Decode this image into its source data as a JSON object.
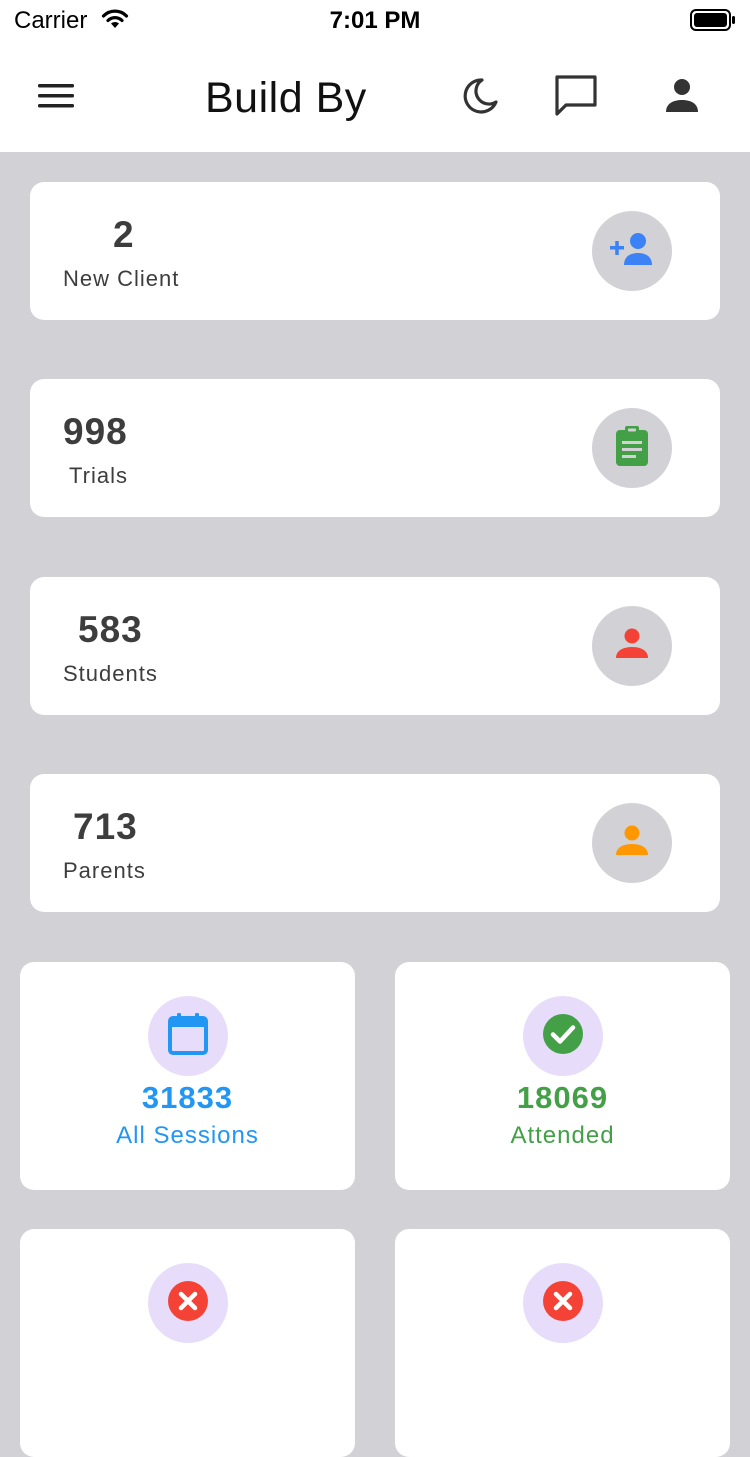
{
  "status_bar": {
    "carrier": "Carrier",
    "time": "7:01 PM"
  },
  "header": {
    "title": "Build By",
    "icons": [
      "menu-icon",
      "moon-icon",
      "chat-icon",
      "person-icon"
    ]
  },
  "stats": [
    {
      "value": "2",
      "label": "New Client",
      "icon": "add-user-icon",
      "icon_color": "#3b82f6"
    },
    {
      "value": "998",
      "label": "Trials",
      "icon": "clipboard-icon",
      "icon_color": "#43a047"
    },
    {
      "value": "583",
      "label": "Students",
      "icon": "person-icon",
      "icon_color": "#f44336"
    },
    {
      "value": "713",
      "label": "Parents",
      "icon": "person-icon",
      "icon_color": "#ff9800"
    }
  ],
  "sessions": [
    {
      "value": "31833",
      "label": "All Sessions",
      "icon": "calendar-icon",
      "color": "#2196f3"
    },
    {
      "value": "18069",
      "label": "Attended",
      "icon": "check-circle-icon",
      "color": "#43a047"
    },
    {
      "value": "",
      "label": "",
      "icon": "cancel-circle-icon",
      "color": "#f44336"
    },
    {
      "value": "",
      "label": "",
      "icon": "cancel-circle-icon",
      "color": "#f44336"
    }
  ],
  "colors": {
    "background": "#d1d1d6",
    "card": "#ffffff",
    "tile_icon_bg": "#e7ddfb"
  }
}
